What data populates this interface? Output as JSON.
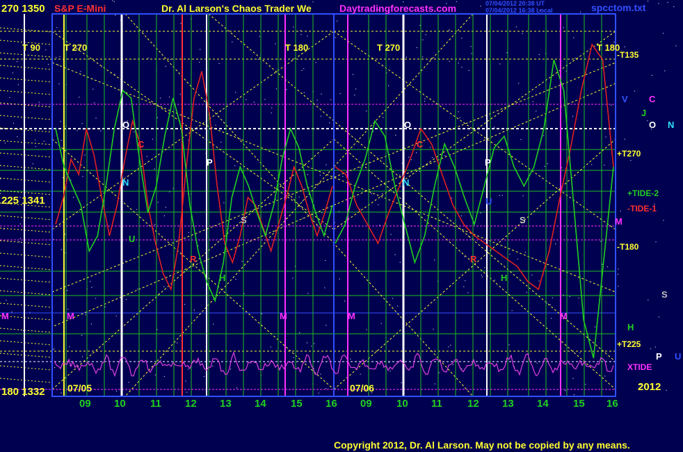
{
  "header": {
    "price_axis_top": "270  1350",
    "instrument": "S&P E-Mini",
    "author_title": "Dr. Al Larson's Chaos Trader We",
    "website": "Daytradingforecasts.com",
    "stamp1": "07/04/2012 20:38 UT",
    "stamp2": "07/04/2012 16:38 Local",
    "data_file": "spcctom.txt"
  },
  "left_axis": {
    "mid": "225  1341",
    "bottom": "180  1332"
  },
  "dates": {
    "first": "07/05",
    "second": "07/06",
    "year": "2012"
  },
  "footer": {
    "copyright": "Copyright 2012, Dr. Al Larson. May not be copied by any means."
  },
  "colors": {
    "background": "#000050",
    "tide1": "#e02020",
    "tide2": "#20d020",
    "xtide": "#e040e0",
    "yellow": "#ffff30",
    "magenta": "#ff30ff",
    "green_grid": "#20c020",
    "blue_grid": "#4060ff"
  },
  "chart_data": {
    "type": "line",
    "title": "S&P E-Mini",
    "x_hour_labels": [
      "09",
      "10",
      "11",
      "12",
      "13",
      "14",
      "15",
      "16",
      "09",
      "10",
      "11",
      "12",
      "13",
      "14",
      "15",
      "16"
    ],
    "price_levels": [
      {
        "angle": "270",
        "price": "1350"
      },
      {
        "angle": "225",
        "price": "1341"
      },
      {
        "angle": "180",
        "price": "1332"
      }
    ],
    "right_labels": [
      {
        "text": "-T135",
        "color": "#ffff30"
      },
      {
        "text": "+T270",
        "color": "#ffff30"
      },
      {
        "text": "+TIDE-2",
        "color": "#20d020"
      },
      {
        "text": "-TIDE-1",
        "color": "#ff3030"
      },
      {
        "text": "-T180",
        "color": "#ffff30"
      },
      {
        "text": "+T225",
        "color": "#ffff30"
      },
      {
        "text": "XTIDE",
        "color": "#ff30ff"
      },
      {
        "text": "2012",
        "color": "#ffff30"
      }
    ],
    "planet_labels_right": [
      {
        "text": "V",
        "color": "#3050ff"
      },
      {
        "text": "C",
        "color": "#ff30ff"
      },
      {
        "text": "J",
        "color": "#20d020"
      },
      {
        "text": "O",
        "color": "#ffffff"
      },
      {
        "text": "N",
        "color": "#30e0ff"
      },
      {
        "text": "M",
        "color": "#ff30ff"
      },
      {
        "text": "S",
        "color": "#c0c0c0"
      },
      {
        "text": "H",
        "color": "#20d020"
      },
      {
        "text": "P",
        "color": "#ffffff"
      },
      {
        "text": "U",
        "color": "#3050ff"
      }
    ],
    "top_markers": [
      "T  90",
      "T  270",
      "T  180",
      "T  270",
      "T  180"
    ],
    "series": [
      {
        "name": "TIDE-1",
        "color": "#e02020",
        "day1": [
          0.45,
          0.52,
          0.62,
          0.58,
          0.7,
          0.63,
          0.52,
          0.42,
          0.5,
          0.62,
          0.72,
          0.66,
          0.5,
          0.4,
          0.32,
          0.28,
          0.4,
          0.6,
          0.78,
          0.85,
          0.74,
          0.55,
          0.4,
          0.35,
          0.42,
          0.52,
          0.5,
          0.44,
          0.38,
          0.45,
          0.52,
          0.6,
          0.55,
          0.48,
          0.42,
          0.48,
          0.55
        ],
        "day2": [
          0.6,
          0.58,
          0.5,
          0.45,
          0.4,
          0.48,
          0.55,
          0.62,
          0.7,
          0.66,
          0.58,
          0.5,
          0.45,
          0.42,
          0.4,
          0.38,
          0.36,
          0.34,
          0.3,
          0.28,
          0.38,
          0.52,
          0.65,
          0.8,
          0.92,
          0.88,
          0.6
        ]
      },
      {
        "name": "TIDE-2",
        "color": "#20d020",
        "day1": [
          0.7,
          0.6,
          0.55,
          0.5,
          0.38,
          0.42,
          0.55,
          0.7,
          0.8,
          0.78,
          0.62,
          0.48,
          0.55,
          0.68,
          0.78,
          0.7,
          0.5,
          0.38,
          0.3,
          0.25,
          0.35,
          0.52,
          0.6,
          0.55,
          0.48,
          0.42,
          0.5,
          0.62,
          0.7,
          0.65,
          0.55,
          0.48,
          0.42,
          0.5
        ],
        "day2": [
          0.4,
          0.45,
          0.55,
          0.62,
          0.72,
          0.68,
          0.55,
          0.45,
          0.35,
          0.42,
          0.55,
          0.66,
          0.6,
          0.52,
          0.45,
          0.55,
          0.65,
          0.68,
          0.6,
          0.55,
          0.6,
          0.7,
          0.88,
          0.8,
          0.5,
          0.2,
          0.1,
          0.35,
          0.6
        ]
      }
    ]
  }
}
